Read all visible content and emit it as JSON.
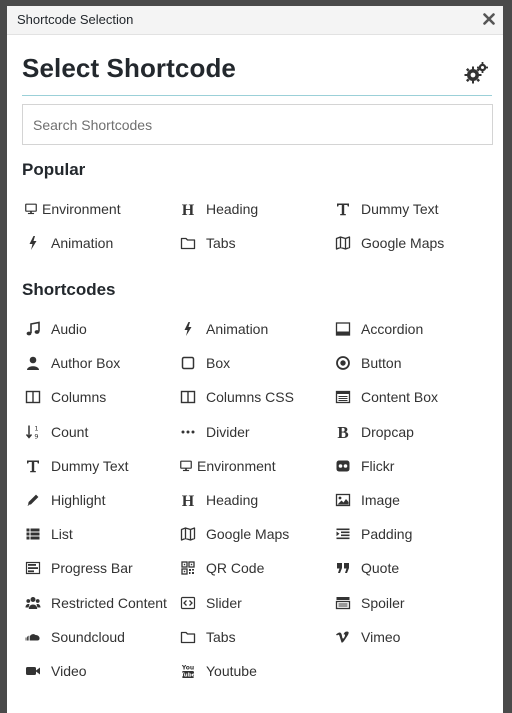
{
  "dialog": {
    "title": "Shortcode Selection",
    "heading": "Select Shortcode",
    "accent_color": "#9bd0d8"
  },
  "search": {
    "placeholder": "Search Shortcodes",
    "value": ""
  },
  "popular": {
    "title": "Popular",
    "items": [
      {
        "label": "Environment",
        "icon": "monitor-icon"
      },
      {
        "label": "Heading",
        "icon": "heading-icon"
      },
      {
        "label": "Dummy Text",
        "icon": "text-icon"
      },
      {
        "label": "Animation",
        "icon": "bolt-icon"
      },
      {
        "label": "Tabs",
        "icon": "folder-icon"
      },
      {
        "label": "Google Maps",
        "icon": "map-icon"
      }
    ]
  },
  "shortcodes": {
    "title": "Shortcodes",
    "items": [
      {
        "label": "Audio",
        "icon": "music-icon"
      },
      {
        "label": "Animation",
        "icon": "bolt-icon"
      },
      {
        "label": "Accordion",
        "icon": "accordion-icon"
      },
      {
        "label": "Author Box",
        "icon": "user-icon"
      },
      {
        "label": "Box",
        "icon": "square-icon"
      },
      {
        "label": "Button",
        "icon": "dot-circle-icon"
      },
      {
        "label": "Columns",
        "icon": "columns-icon"
      },
      {
        "label": "Columns CSS",
        "icon": "columns-icon"
      },
      {
        "label": "Content Box",
        "icon": "list-box-icon"
      },
      {
        "label": "Count",
        "icon": "sort-numeric-icon"
      },
      {
        "label": "Divider",
        "icon": "ellipsis-icon"
      },
      {
        "label": "Dropcap",
        "icon": "bold-icon"
      },
      {
        "label": "Dummy Text",
        "icon": "text-icon"
      },
      {
        "label": "Environment",
        "icon": "monitor-icon"
      },
      {
        "label": "Flickr",
        "icon": "flickr-icon"
      },
      {
        "label": "Highlight",
        "icon": "pencil-icon"
      },
      {
        "label": "Heading",
        "icon": "heading-icon"
      },
      {
        "label": "Image",
        "icon": "image-icon"
      },
      {
        "label": "List",
        "icon": "list-icon"
      },
      {
        "label": "Google Maps",
        "icon": "map-icon"
      },
      {
        "label": "Padding",
        "icon": "indent-icon"
      },
      {
        "label": "Progress Bar",
        "icon": "tasks-icon"
      },
      {
        "label": "QR Code",
        "icon": "qrcode-icon"
      },
      {
        "label": "Quote",
        "icon": "quote-icon"
      },
      {
        "label": "Restricted Content",
        "icon": "users-icon"
      },
      {
        "label": "Slider",
        "icon": "code-icon"
      },
      {
        "label": "Spoiler",
        "icon": "spoiler-icon"
      },
      {
        "label": "Soundcloud",
        "icon": "soundcloud-icon"
      },
      {
        "label": "Tabs",
        "icon": "folder-icon"
      },
      {
        "label": "Vimeo",
        "icon": "vimeo-icon"
      },
      {
        "label": "Video",
        "icon": "video-camera-icon"
      },
      {
        "label": "Youtube",
        "icon": "youtube-icon"
      }
    ]
  }
}
